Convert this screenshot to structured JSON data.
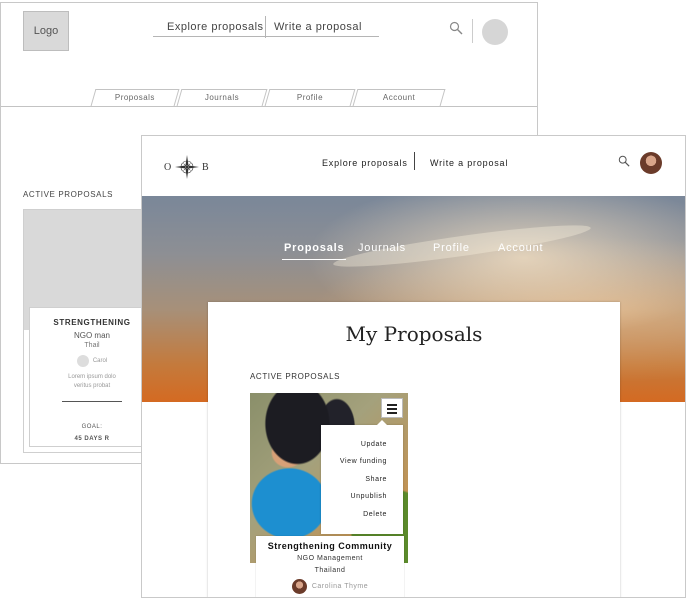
{
  "wireframe": {
    "logo": "Logo",
    "nav": [
      "Explore proposals",
      "Write a proposal"
    ],
    "tabs": [
      "Proposals",
      "Journals",
      "Profile",
      "Account"
    ],
    "section": "ACTIVE PROPOSALS",
    "card": {
      "title": "STRENGTHENING",
      "org": "NGO man",
      "country": "Thail",
      "author": "Carol",
      "lorem1": "Lorem ipsum dolo",
      "lorem2": "veritus probat",
      "goal": "GOAL:",
      "days": "45 DAYS R"
    }
  },
  "site": {
    "logo": {
      "left": "O",
      "right": "B"
    },
    "nav": [
      "Explore proposals",
      "Write a proposal"
    ],
    "tabs": [
      "Proposals",
      "Journals",
      "Profile",
      "Account"
    ],
    "active_tab": "Proposals",
    "page_title": "My Proposals",
    "section": "ACTIVE PROPOSALS",
    "card": {
      "title": "Strengthening Community",
      "org": "NGO Management",
      "country": "Thailand",
      "author": "Carolina Thyme"
    },
    "menu": [
      "Update",
      "View funding",
      "Share",
      "Unpublish",
      "Delete"
    ],
    "colors": {
      "text": "#222222",
      "panel": "#ffffff",
      "hero_orange": "#d46a22"
    }
  }
}
